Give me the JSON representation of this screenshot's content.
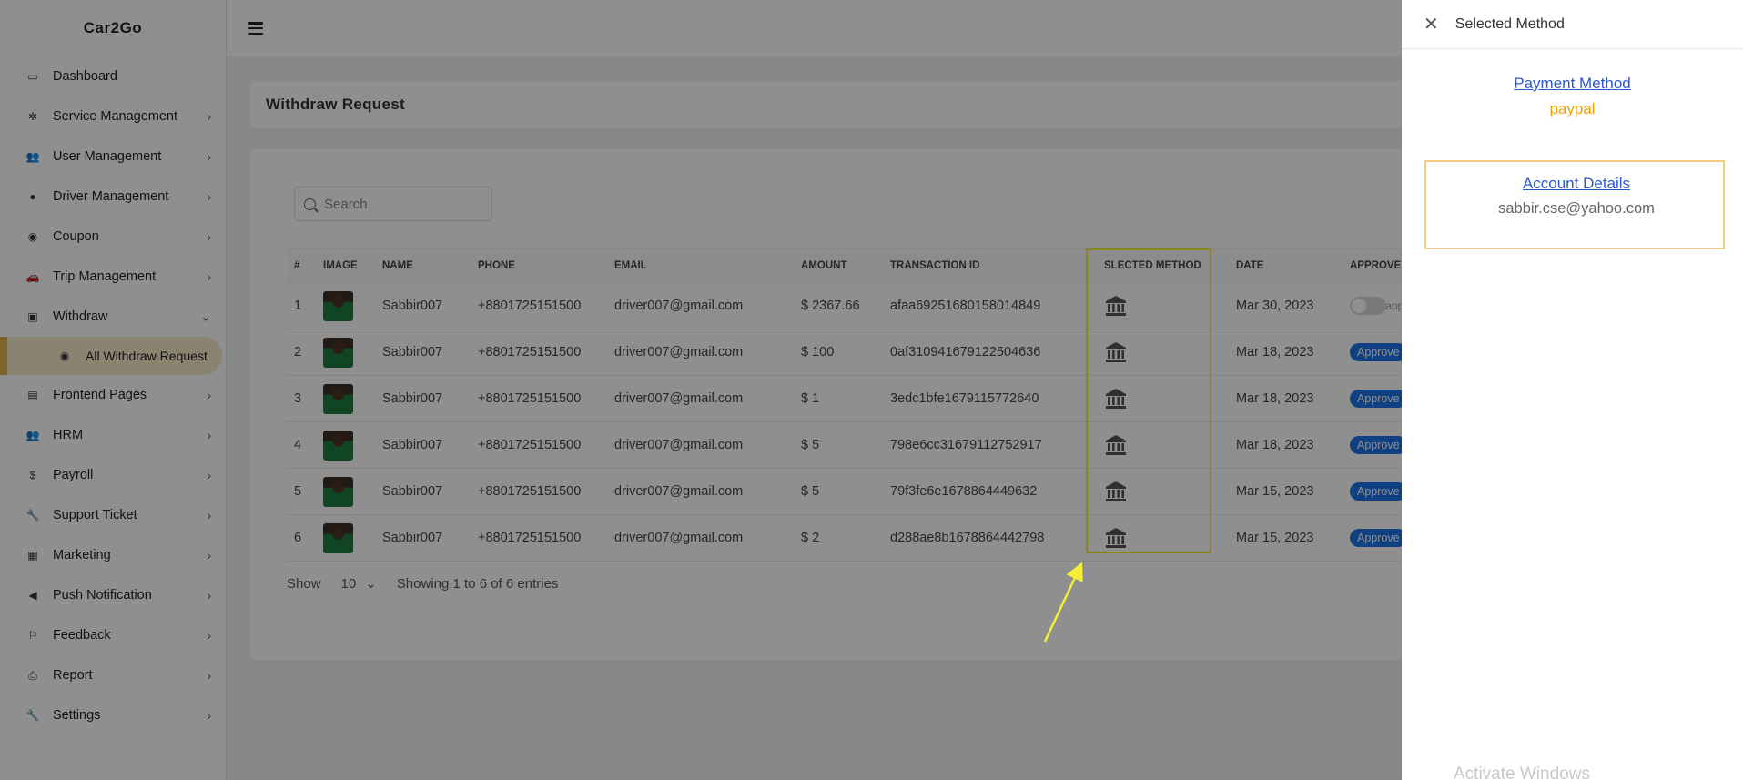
{
  "brand": "Car2Go",
  "sidebar": {
    "items": [
      {
        "label": "Dashboard",
        "icon": "laptop-icon",
        "glyph": "▭",
        "chevron": ""
      },
      {
        "label": "Service Management",
        "icon": "service-icon",
        "glyph": "✲",
        "chevron": "›"
      },
      {
        "label": "User Management",
        "icon": "users-icon",
        "glyph": "👥",
        "chevron": "›"
      },
      {
        "label": "Driver Management",
        "icon": "user-icon",
        "glyph": "●",
        "chevron": "›"
      },
      {
        "label": "Coupon",
        "icon": "coupon-icon",
        "glyph": "◉",
        "chevron": "›"
      },
      {
        "label": "Trip Management",
        "icon": "car-icon",
        "glyph": "🚗",
        "chevron": "›"
      },
      {
        "label": "Withdraw",
        "icon": "withdraw-icon",
        "glyph": "▣",
        "chevron": "⌄"
      }
    ],
    "sub_item": {
      "label": "All Withdraw Request",
      "icon": "coin-icon",
      "glyph": "◉"
    },
    "items_after": [
      {
        "label": "Frontend Pages",
        "icon": "pages-icon",
        "glyph": "▤",
        "chevron": "›"
      },
      {
        "label": "HRM",
        "icon": "hrm-icon",
        "glyph": "👥",
        "chevron": "›"
      },
      {
        "label": "Payroll",
        "icon": "dollar-icon",
        "glyph": "$",
        "chevron": "›"
      },
      {
        "label": "Support Ticket",
        "icon": "wrench-icon",
        "glyph": "🔧",
        "chevron": "›"
      },
      {
        "label": "Marketing",
        "icon": "grid-icon",
        "glyph": "▦",
        "chevron": "›"
      },
      {
        "label": "Push Notification",
        "icon": "megaphone-icon",
        "glyph": "◀",
        "chevron": "›"
      },
      {
        "label": "Feedback",
        "icon": "feedback-icon",
        "glyph": "⚐",
        "chevron": "›"
      },
      {
        "label": "Report",
        "icon": "printer-icon",
        "glyph": "⎙",
        "chevron": "›"
      },
      {
        "label": "Settings",
        "icon": "settings-icon",
        "glyph": "🔧",
        "chevron": "›"
      }
    ]
  },
  "page": {
    "title": "Withdraw Request",
    "search_placeholder": "Search"
  },
  "table": {
    "columns": [
      "#",
      "IMAGE",
      "NAME",
      "PHONE",
      "EMAIL",
      "AMOUNT",
      "TRANSACTION ID",
      "SLECTED METHOD",
      "DATE",
      "APPROVED"
    ],
    "rows": [
      {
        "num": "1",
        "name": "Sabbir007",
        "phone": "+8801725151500",
        "email": "driver007@gmail.com",
        "amount": "$ 2367.66",
        "txn": "afaa69251680158014849",
        "date": "Mar 30, 2023",
        "status": "Disapprove",
        "status_type": "toggle"
      },
      {
        "num": "2",
        "name": "Sabbir007",
        "phone": "+8801725151500",
        "email": "driver007@gmail.com",
        "amount": "$ 100",
        "txn": "0af310941679122504636",
        "date": "Mar 18, 2023",
        "status": "Approve",
        "status_type": "badge"
      },
      {
        "num": "3",
        "name": "Sabbir007",
        "phone": "+8801725151500",
        "email": "driver007@gmail.com",
        "amount": "$ 1",
        "txn": "3edc1bfe1679115772640",
        "date": "Mar 18, 2023",
        "status": "Approve",
        "status_type": "badge"
      },
      {
        "num": "4",
        "name": "Sabbir007",
        "phone": "+8801725151500",
        "email": "driver007@gmail.com",
        "amount": "$ 5",
        "txn": "798e6cc31679112752917",
        "date": "Mar 18, 2023",
        "status": "Approve",
        "status_type": "badge"
      },
      {
        "num": "5",
        "name": "Sabbir007",
        "phone": "+8801725151500",
        "email": "driver007@gmail.com",
        "amount": "$ 5",
        "txn": "79f3fe6e1678864449632",
        "date": "Mar 15, 2023",
        "status": "Approve",
        "status_type": "badge"
      },
      {
        "num": "6",
        "name": "Sabbir007",
        "phone": "+8801725151500",
        "email": "driver007@gmail.com",
        "amount": "$ 2",
        "txn": "d288ae8b1678864442798",
        "date": "Mar 15, 2023",
        "status": "Approve",
        "status_type": "badge"
      }
    ]
  },
  "footer": {
    "show_label": "Show",
    "page_size": "10",
    "entries_text": "Showing 1 to 6 of 6 entries"
  },
  "drawer": {
    "title": "Selected Method",
    "payment_method_label": "Payment Method",
    "payment_method_value": "paypal",
    "account_details_label": "Account Details",
    "account_details_value": "sabbir.cse@yahoo.com",
    "watermark": "Activate Windows"
  },
  "colors": {
    "highlight_yellow": "#f4ee36",
    "arrow_red": "#e01b1b",
    "link_blue": "#2a55d4",
    "paypal_orange": "#f5a000",
    "approve_blue": "#1a73e8"
  }
}
